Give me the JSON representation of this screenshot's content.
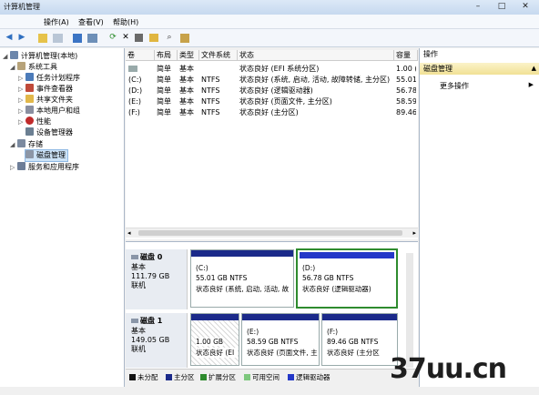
{
  "window": {
    "title": "计算机管理",
    "min": "–",
    "max": "□",
    "close": "✕"
  },
  "menu": [
    "操作(A)",
    "查看(V)",
    "帮助(H)"
  ],
  "toolbar": {
    "back": "◀",
    "forward": "▶",
    "delete": "✕",
    "icons": [
      "folder-up-icon",
      "grid-icon",
      "help-icon",
      "console-icon",
      "refresh-icon",
      "delete-icon",
      "properties-icon",
      "open-icon",
      "search-icon",
      "export-icon"
    ]
  },
  "tree": {
    "root": "计算机管理(本地)",
    "system_tools": "系统工具",
    "task_scheduler": "任务计划程序",
    "event_viewer": "事件查看器",
    "shared_folders": "共享文件夹",
    "local_users": "本地用户和组",
    "performance": "性能",
    "device_manager": "设备管理器",
    "storage": "存储",
    "disk_mgmt": "磁盘管理",
    "services": "服务和应用程序"
  },
  "columns": [
    "卷",
    "布局",
    "类型",
    "文件系统",
    "状态",
    "容量"
  ],
  "volumes": [
    {
      "vol": "",
      "layout": "简单",
      "type": "基本",
      "fs": "",
      "status": "状态良好 (EFI 系统分区)",
      "cap": "1.00 ("
    },
    {
      "vol": "(C:)",
      "layout": "简单",
      "type": "基本",
      "fs": "NTFS",
      "status": "状态良好 (系统, 启动, 活动, 故障转储, 主分区)",
      "cap": "55.01"
    },
    {
      "vol": "(D:)",
      "layout": "简单",
      "type": "基本",
      "fs": "NTFS",
      "status": "状态良好 (逻辑驱动器)",
      "cap": "56.78"
    },
    {
      "vol": "(E:)",
      "layout": "简单",
      "type": "基本",
      "fs": "NTFS",
      "status": "状态良好 (页面文件, 主分区)",
      "cap": "58.59"
    },
    {
      "vol": "(F:)",
      "layout": "简单",
      "type": "基本",
      "fs": "NTFS",
      "status": "状态良好 (主分区)",
      "cap": "89.46"
    }
  ],
  "disks": [
    {
      "name": "磁盘 0",
      "type": "基本",
      "size": "111.79 GB",
      "state": "联机",
      "parts": [
        {
          "label": "(C:)",
          "size": "55.01 GB NTFS",
          "status": "状态良好 (系统, 启动, 活动, 故"
        },
        {
          "label": "(D:)",
          "size": "56.78 GB NTFS",
          "status": "状态良好 (逻辑驱动器)"
        }
      ]
    },
    {
      "name": "磁盘 1",
      "type": "基本",
      "size": "149.05 GB",
      "state": "联机",
      "parts": [
        {
          "label": "",
          "size": "1.00 GB",
          "status": "状态良好 (EI"
        },
        {
          "label": "(E:)",
          "size": "58.59 GB NTFS",
          "status": "状态良好 (页面文件, 主"
        },
        {
          "label": "(F:)",
          "size": "89.46 GB NTFS",
          "status": "状态良好 (主分区"
        }
      ]
    }
  ],
  "legend": [
    {
      "label": "未分配",
      "color": "#111111"
    },
    {
      "label": "主分区",
      "color": "#1b2a8a"
    },
    {
      "label": "扩展分区",
      "color": "#2e8b2e"
    },
    {
      "label": "可用空间",
      "color": "#7ec87e"
    },
    {
      "label": "逻辑驱动器",
      "color": "#2438c8"
    }
  ],
  "actions": {
    "header": "操作",
    "selected": "磁盘管理",
    "more": "更多操作"
  },
  "watermark": "37uu.cn"
}
